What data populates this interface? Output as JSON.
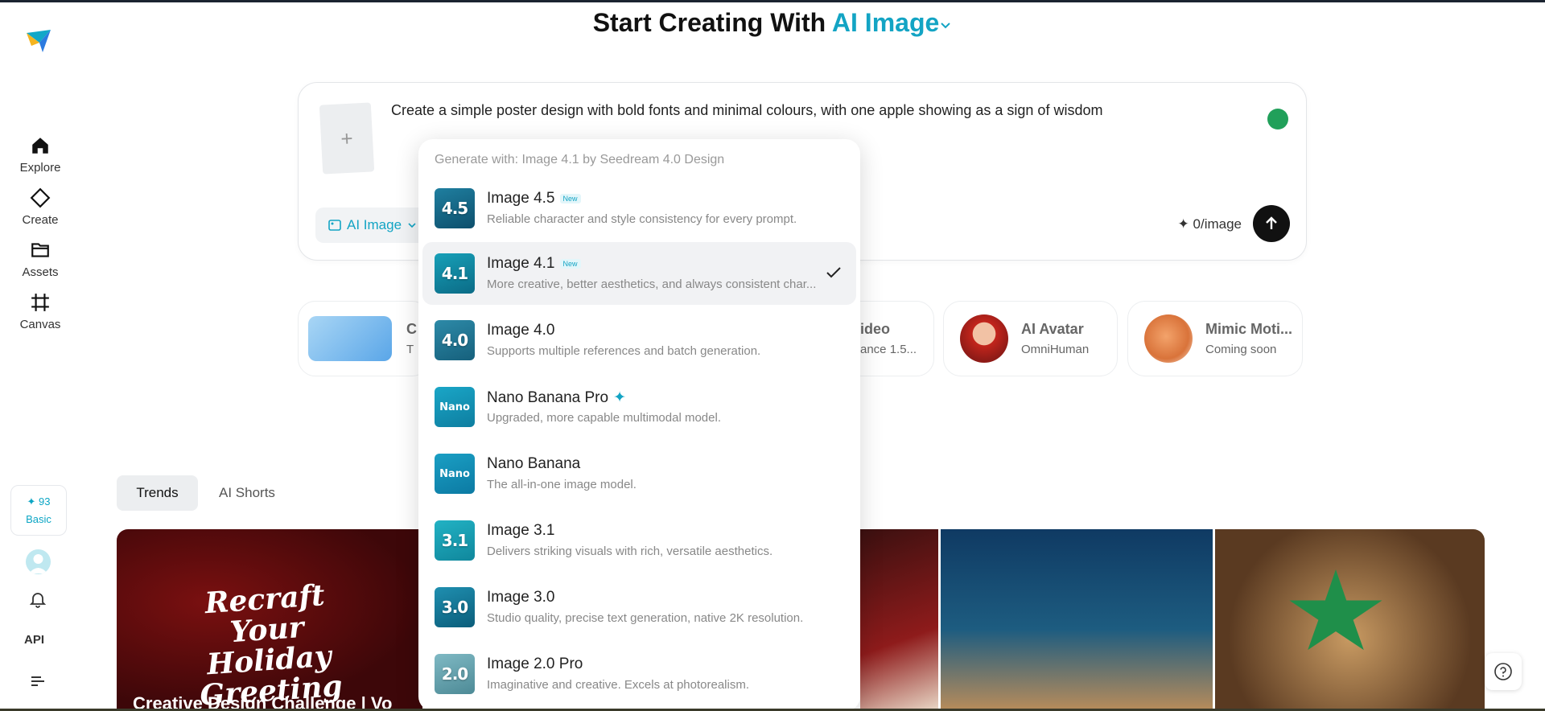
{
  "header": {
    "prefix": "Start Creating With",
    "mode": "AI Image"
  },
  "sidebar": {
    "items": [
      {
        "label": "Explore",
        "icon": "home-icon"
      },
      {
        "label": "Create",
        "icon": "diamond-icon"
      },
      {
        "label": "Assets",
        "icon": "folder-icon"
      },
      {
        "label": "Canvas",
        "icon": "canvas-icon"
      }
    ],
    "credits": "93",
    "plan": "Basic",
    "api_label": "API"
  },
  "prompt": {
    "text": "Create a simple poster design with bold fonts and minimal colours, with one apple showing as a sign of wisdom",
    "type_label": "AI Image",
    "cost": "0/image"
  },
  "features": [
    {
      "title": "C",
      "sub": "T"
    },
    {
      "title": "ideo",
      "sub": "ance 1.5..."
    },
    {
      "title": "AI Avatar",
      "sub": "OmniHuman"
    },
    {
      "title": "Mimic Moti...",
      "sub": "Coming soon"
    }
  ],
  "tabs": [
    {
      "label": "Trends",
      "active": true
    },
    {
      "label": "AI Shorts",
      "active": false
    }
  ],
  "gallery": {
    "holiday_text": "Recraft Your Holiday Greeting",
    "challenge_text": "Creative Design Challenge | Vo"
  },
  "dropdown": {
    "header": "Generate with: Image 4.1 by Seedream 4.0 Design",
    "new_badge": "New",
    "options": [
      {
        "name": "Image 4.5",
        "desc": "Reliable character and style consistency for every prompt.",
        "badge": "New",
        "icon_text": "4.5",
        "selected": false
      },
      {
        "name": "Image 4.1",
        "desc": "More creative, better aesthetics, and always consistent char...",
        "badge": "New",
        "icon_text": "4.1",
        "selected": true
      },
      {
        "name": "Image 4.0",
        "desc": "Supports multiple references and batch generation.",
        "icon_text": "4.0",
        "selected": false
      },
      {
        "name": "Nano Banana Pro",
        "desc": "Upgraded, more capable multimodal model.",
        "icon_text": "Nano",
        "selected": false
      },
      {
        "name": "Nano Banana",
        "desc": "The all-in-one image model.",
        "icon_text": "Nano",
        "selected": false
      },
      {
        "name": "Image 3.1",
        "desc": "Delivers striking visuals with rich, versatile aesthetics.",
        "icon_text": "3.1",
        "selected": false
      },
      {
        "name": "Image 3.0",
        "desc": "Studio quality, precise text generation, native 2K resolution.",
        "icon_text": "3.0",
        "selected": false
      },
      {
        "name": "Image 2.0 Pro",
        "desc": "Imaginative and creative. Excels at photorealism.",
        "icon_text": "2.0",
        "selected": false
      }
    ]
  },
  "colors": {
    "accent": "#13a4c4",
    "selected_bg": "#f1f2f4"
  }
}
